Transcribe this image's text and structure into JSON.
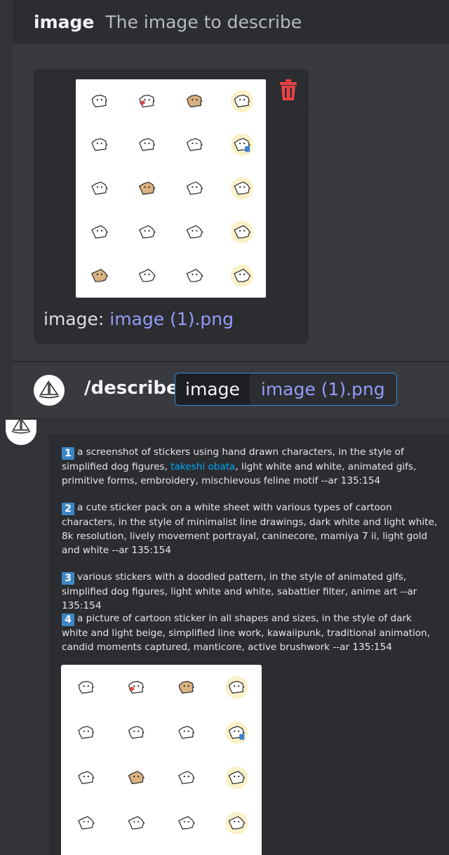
{
  "param": {
    "name": "image",
    "description": "The image to describe"
  },
  "upload": {
    "label": "image:",
    "filename": "image (1).png",
    "image_alt": "sheet of hand-drawn white dog stickers"
  },
  "command": {
    "name": "/describe",
    "option_key": "image",
    "option_value": "image (1).png"
  },
  "prompts": [
    {
      "num": "1",
      "text_before": "a screenshot of stickers using hand drawn characters, in the style of simplified dog figures, ",
      "highlight": "takeshi obata",
      "text_after": ", light white and white, animated gifs, primitive forms, embroidery, mischievous feline motif --ar 135:154"
    },
    {
      "num": "2",
      "text_before": "a cute sticker pack on a white sheet with various types of cartoon characters, in the style of minimalist line drawings, dark white and light white, 8k resolution, lively movement portrayal, caninecore, mamiya 7 ii, light gold and white --ar 135:154",
      "highlight": "",
      "text_after": ""
    },
    {
      "num": "3",
      "text_before": "various stickers with a doodled pattern, in the style of animated gifs, simplified dog figures, light white and white, sabattier filter, anime art --ar 135:154",
      "highlight": "",
      "text_after": ""
    },
    {
      "num": "4",
      "text_before": "a picture of cartoon sticker in all shapes and sizes, in the style of dark white and light beige, simplified line work, kawaiipunk, traditional animation, candid moments captured, manticore, active brushwork --ar 135:154",
      "highlight": "",
      "text_after": ""
    }
  ],
  "icons": {
    "trash": "trash-icon",
    "avatar": "sailboat-logo-icon"
  },
  "colors": {
    "trash": "#ed4245",
    "link": "#949cf7",
    "highlight": "#00a8fc",
    "number_badge": "#3d86c6",
    "chip_border": "#2f8bd6"
  }
}
